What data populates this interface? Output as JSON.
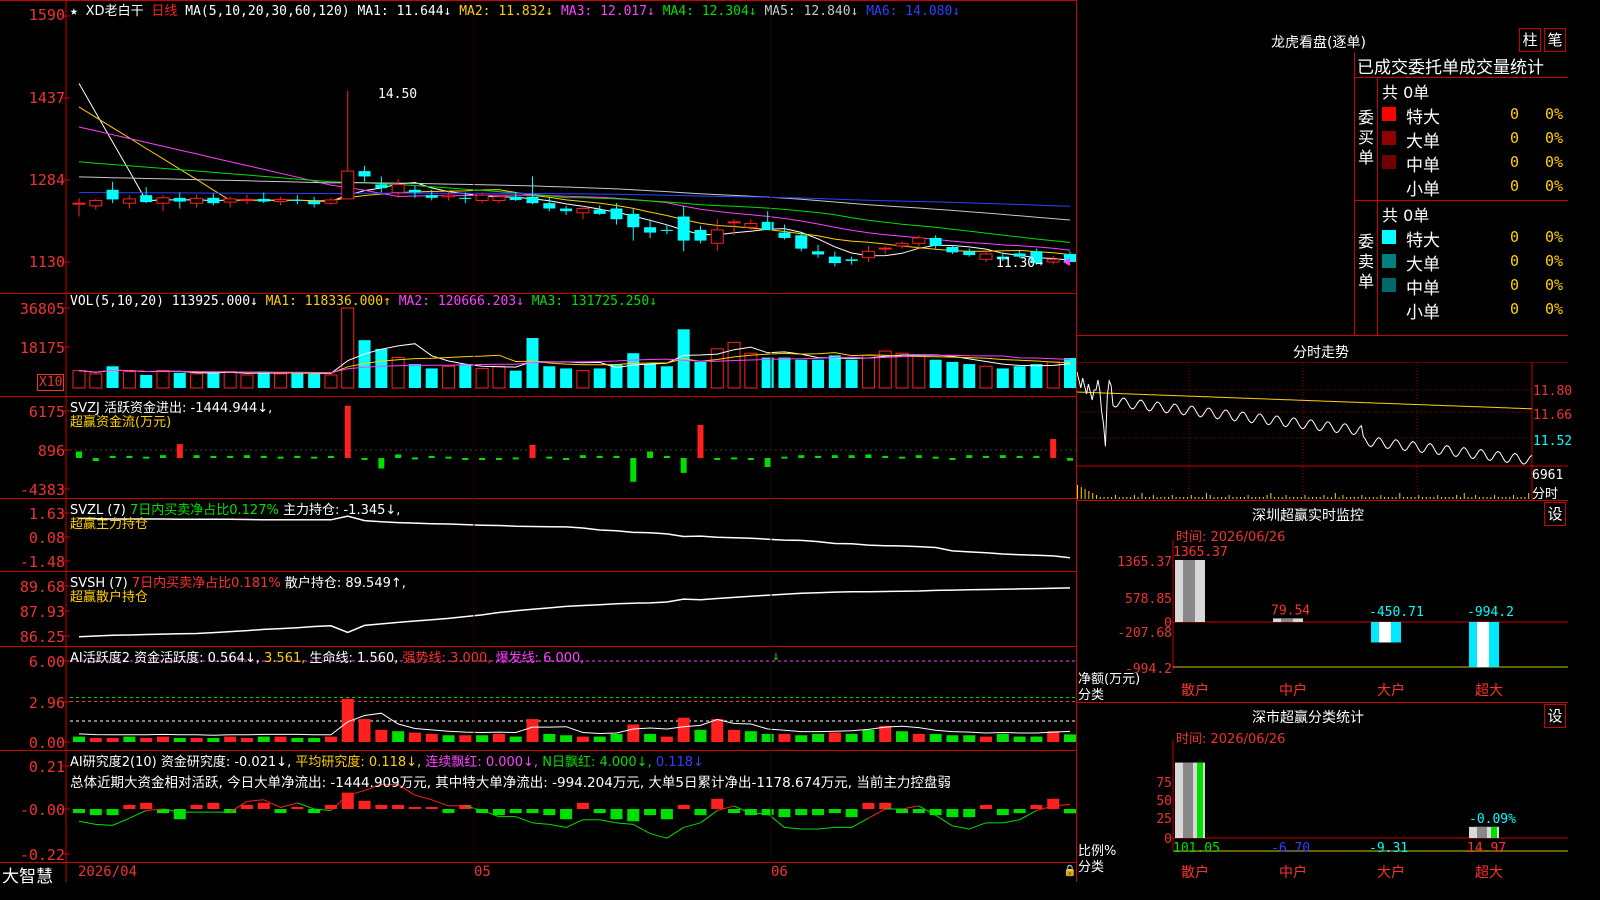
{
  "header": {
    "star": "★",
    "stock_name": "XD老白干",
    "period": "日线",
    "ma_def": "MA(5,10,20,30,60,120)",
    "ma_items": [
      {
        "label": "MA1: 11.644↓",
        "color": "#ffffff"
      },
      {
        "label": "MA2: 11.832↓",
        "color": "#ffd000"
      },
      {
        "label": "MA3: 12.017↓",
        "color": "#ff40ff"
      },
      {
        "label": "MA4: 12.304↓",
        "color": "#00e000"
      },
      {
        "label": "MA5: 12.840↓",
        "color": "#c8c8c8"
      },
      {
        "label": "MA6: 14.080↓",
        "color": "#3040ff"
      }
    ]
  },
  "panels": {
    "price": {
      "ticks": [
        "1590",
        "1437",
        "1284",
        "1130"
      ],
      "high_label": "14.50",
      "low_label": "11.30→"
    },
    "vol": {
      "ticks": [
        "36805",
        "18175"
      ],
      "unit_label": "X10",
      "def": "VOL(5,10,20)",
      "items": [
        {
          "label": "113925.000↓",
          "color": "#ffffff"
        },
        {
          "label": "MA1: 118336.000↑",
          "color": "#ffd000"
        },
        {
          "label": "MA2: 120666.203↓",
          "color": "#ff40ff"
        },
        {
          "label": "MA3: 131725.250↓",
          "color": "#00e000"
        }
      ]
    },
    "svzj": {
      "ticks": [
        "6175",
        "896",
        "-4383"
      ],
      "line1": "SVZJ  活跃资金进出: -1444.944↓,",
      "line2": "超赢资金流(万元)"
    },
    "svzl": {
      "ticks": [
        "1.63",
        "0.08",
        "-1.48"
      ],
      "line1a": "SVZL (7)",
      "line1b": "7日内买卖净占比0.127%",
      "line1c": "主力持仓: -1.345↓,",
      "line2": "超赢主力持仓"
    },
    "svsh": {
      "ticks": [
        "89.68",
        "87.93",
        "86.25"
      ],
      "line1a": "SVSH (7)",
      "line1b": "7日内买卖净占比0.181%",
      "line1c": "散户持仓: 89.549↑,",
      "line2": "超赢散户持仓"
    },
    "ai_active": {
      "ticks": [
        "6.00",
        "2.96",
        "0.00"
      ],
      "items": [
        {
          "label": "AI活跃度2 资金活跃度: 0.564↓,",
          "color": "#ffffff"
        },
        {
          "label": "3.561,",
          "color": "#ffd000"
        },
        {
          "label": "生命线: 1.560,",
          "color": "#ffffff"
        },
        {
          "label": "强势线: 3.000,",
          "color": "#ff3030"
        },
        {
          "label": "爆发线: 6.000,",
          "color": "#ff40ff"
        }
      ]
    },
    "ai_research": {
      "ticks": [
        "0.21",
        "-0.00",
        "-0.22"
      ],
      "items": [
        {
          "label": "AI研究度2(10) 资金研究度: -0.021↓,",
          "color": "#ffffff"
        },
        {
          "label": "平均研究度: 0.118↓,",
          "color": "#ffd000"
        },
        {
          "label": "连续飘红: 0.000↓,",
          "color": "#ff40ff"
        },
        {
          "label": "N日飘红: 4.000↓,",
          "color": "#00e000"
        },
        {
          "label": "0.118↓",
          "color": "#3040ff"
        }
      ],
      "summary": "总体近期大资金相对活跃, 今日大单净流出: -1444.909万元, 其中特大单净流出: -994.204万元, 大单5日累计净出-1178.674万元, 当前主力控盘弱"
    }
  },
  "date_axis": {
    "labels": [
      "2026/04",
      "05",
      "06"
    ]
  },
  "footer": {
    "brand": "大智慧"
  },
  "side": {
    "lhb": {
      "title": "龙虎看盘(逐单)",
      "btn_bar": "柱",
      "btn_stroke": "笔",
      "tabs": "已成交委托单成交量统计",
      "buy": {
        "label": "委买单",
        "total": "共 0单",
        "rows": [
          {
            "name": "特大",
            "count": "0",
            "pct": "0%",
            "color": "#ff0000"
          },
          {
            "name": "大单",
            "count": "0",
            "pct": "0%",
            "color": "#900000"
          },
          {
            "name": "中单",
            "count": "0",
            "pct": "0%",
            "color": "#700000"
          },
          {
            "name": "小单",
            "count": "0",
            "pct": "0%",
            "color": ""
          }
        ]
      },
      "sell": {
        "label": "委卖单",
        "total": "共 0单",
        "rows": [
          {
            "name": "特大",
            "count": "0",
            "pct": "0%",
            "color": "#00ffff"
          },
          {
            "name": "大单",
            "count": "0",
            "pct": "0%",
            "color": "#008080"
          },
          {
            "name": "中单",
            "count": "0",
            "pct": "0%",
            "color": "#006868"
          },
          {
            "name": "小单",
            "count": "0",
            "pct": "0%",
            "color": ""
          }
        ]
      }
    },
    "fenshi": {
      "title": "分时走势",
      "ticks": [
        "11.80",
        "11.66",
        "11.52"
      ],
      "vol_tick": "6961",
      "vol_unit": "分时"
    },
    "monitor": {
      "title": "深圳超赢实时监控",
      "btn": "设",
      "time": "时间: 2026/06/26",
      "ticks": [
        "1365.37",
        "578.85",
        "0",
        "-207.68",
        "-994.2"
      ],
      "y_label": "净额(万元)",
      "x_label": "分类",
      "categories": [
        "散户",
        "中户",
        "大户",
        "超大"
      ],
      "values": [
        1365.37,
        79.54,
        -450.71,
        -994.2
      ],
      "value_labels": [
        "1365.37",
        "79.54",
        "-450.71",
        "-994.2"
      ]
    },
    "classify": {
      "title": "深市超赢分类统计",
      "btn": "设",
      "time": "时间: 2026/06/26",
      "ticks": [
        "75",
        "50",
        "25",
        "0"
      ],
      "y_label": "比例%",
      "x_label": "分类",
      "categories": [
        "散户",
        "中户",
        "大户",
        "超大"
      ],
      "values": [
        101.05,
        -6.7,
        -9.31,
        14.97
      ],
      "value_labels": [
        "101.05",
        "-6.70",
        "-9.31",
        "14.97"
      ],
      "extra_label": "-0.09%"
    }
  },
  "chart_data": [
    {
      "type": "candlestick",
      "title": "XD老白干 日线",
      "ylabel": "",
      "ylim": [
        11.2,
        15.95
      ],
      "ohlc": [
        [
          12.4,
          12.5,
          12.15,
          12.4
        ],
        [
          12.35,
          12.48,
          12.28,
          12.45
        ],
        [
          12.65,
          12.8,
          12.4,
          12.47
        ],
        [
          12.4,
          12.55,
          12.3,
          12.48
        ],
        [
          12.55,
          12.7,
          12.4,
          12.42
        ],
        [
          12.4,
          12.55,
          12.25,
          12.5
        ],
        [
          12.5,
          12.6,
          12.3,
          12.43
        ],
        [
          12.4,
          12.56,
          12.32,
          12.49
        ],
        [
          12.5,
          12.58,
          12.36,
          12.4
        ],
        [
          12.42,
          12.52,
          12.32,
          12.48
        ],
        [
          12.45,
          12.56,
          12.38,
          12.47
        ],
        [
          12.48,
          12.6,
          12.4,
          12.43
        ],
        [
          12.43,
          12.52,
          12.36,
          12.47
        ],
        [
          12.46,
          12.55,
          12.38,
          12.44
        ],
        [
          12.44,
          12.52,
          12.32,
          12.38
        ],
        [
          12.4,
          12.5,
          12.36,
          12.46
        ],
        [
          12.48,
          14.5,
          12.7,
          13.0
        ],
        [
          13.0,
          13.1,
          12.8,
          12.9
        ],
        [
          12.75,
          12.9,
          12.6,
          12.68
        ],
        [
          12.6,
          12.85,
          12.5,
          12.75
        ],
        [
          12.65,
          12.72,
          12.5,
          12.6
        ],
        [
          12.55,
          12.65,
          12.45,
          12.5
        ],
        [
          12.52,
          12.62,
          12.45,
          12.55
        ],
        [
          12.5,
          12.6,
          12.4,
          12.48
        ],
        [
          12.45,
          12.6,
          12.4,
          12.55
        ],
        [
          12.45,
          12.55,
          12.4,
          12.52
        ],
        [
          12.52,
          12.6,
          12.44,
          12.46
        ],
        [
          12.52,
          12.9,
          12.38,
          12.4
        ],
        [
          12.4,
          12.5,
          12.25,
          12.3
        ],
        [
          12.3,
          12.35,
          12.18,
          12.25
        ],
        [
          12.22,
          12.35,
          12.1,
          12.3
        ],
        [
          12.28,
          12.36,
          12.18,
          12.2
        ],
        [
          12.3,
          12.4,
          12.0,
          12.1
        ],
        [
          12.2,
          12.3,
          11.7,
          11.95
        ],
        [
          11.95,
          12.1,
          11.75,
          11.85
        ],
        [
          11.9,
          12.0,
          11.82,
          11.88
        ],
        [
          12.15,
          12.35,
          11.5,
          11.7
        ],
        [
          11.9,
          11.98,
          11.65,
          11.7
        ],
        [
          11.65,
          12.1,
          11.5,
          11.9
        ],
        [
          12.05,
          12.1,
          11.8,
          12.05
        ],
        [
          11.95,
          12.1,
          11.9,
          12.02
        ],
        [
          12.05,
          12.25,
          11.9,
          11.9
        ],
        [
          11.85,
          12.0,
          11.72,
          11.75
        ],
        [
          11.8,
          11.85,
          11.5,
          11.55
        ],
        [
          11.5,
          11.62,
          11.38,
          11.44
        ],
        [
          11.4,
          11.5,
          11.22,
          11.28
        ],
        [
          11.35,
          11.4,
          11.25,
          11.32
        ],
        [
          11.38,
          11.6,
          11.3,
          11.5
        ],
        [
          11.55,
          11.6,
          11.45,
          11.56
        ],
        [
          11.6,
          11.68,
          11.55,
          11.65
        ],
        [
          11.65,
          11.8,
          11.55,
          11.75
        ],
        [
          11.75,
          11.8,
          11.55,
          11.6
        ],
        [
          11.58,
          11.62,
          11.45,
          11.48
        ],
        [
          11.5,
          11.55,
          11.4,
          11.43
        ],
        [
          11.35,
          11.48,
          11.3,
          11.45
        ],
        [
          11.4,
          11.48,
          11.32,
          11.35
        ],
        [
          11.46,
          11.52,
          11.38,
          11.4
        ],
        [
          11.5,
          11.55,
          11.25,
          11.28
        ],
        [
          11.3,
          11.42,
          11.25,
          11.35
        ],
        [
          11.45,
          11.5,
          11.3,
          11.3
        ]
      ]
    },
    {
      "type": "bar",
      "title": "VOL(5,10,20)",
      "ylim": [
        0,
        42000
      ],
      "values": [
        8000,
        6500,
        10000,
        7500,
        6000,
        8000,
        7000,
        6500,
        7000,
        7500,
        6000,
        7500,
        6500,
        7000,
        6500,
        6000,
        36805,
        22000,
        18000,
        14000,
        11000,
        9000,
        10000,
        11000,
        9000,
        10000,
        8000,
        23000,
        10000,
        9000,
        8000,
        9000,
        11000,
        16000,
        11000,
        10000,
        27000,
        12000,
        18000,
        21000,
        16000,
        14000,
        14000,
        13000,
        13000,
        15000,
        13000,
        15000,
        17000,
        16000,
        15000,
        13000,
        12000,
        11000,
        10000,
        9000,
        10000,
        11000,
        12000,
        13800
      ]
    },
    {
      "type": "bar",
      "title": "超赢资金流(万元)",
      "ylim": [
        -4383,
        6175
      ],
      "values": [
        -200,
        -1500,
        -800,
        -800,
        -900,
        -700,
        800,
        -700,
        -800,
        -800,
        -700,
        -800,
        -900,
        -800,
        -900,
        -800,
        6000,
        -1200,
        -2500,
        -600,
        -1000,
        -800,
        -900,
        -1300,
        -1200,
        -1100,
        -1000,
        700,
        -900,
        -1200,
        -700,
        -800,
        -800,
        -4300,
        -200,
        -800,
        -3100,
        3400,
        -1200,
        -1000,
        -1100,
        -2300,
        -900,
        -700,
        -800,
        -700,
        -700,
        -600,
        -800,
        -900,
        -700,
        -900,
        -1200,
        -700,
        -800,
        -700,
        -800,
        -800,
        1500,
        -1444.944
      ]
    },
    {
      "type": "line",
      "title": "超赢主力持仓",
      "ylim": [
        -1.48,
        1.63
      ],
      "values": [
        1.2,
        1.18,
        1.16,
        1.16,
        1.16,
        1.16,
        1.15,
        1.15,
        1.14,
        1.14,
        1.13,
        1.12,
        1.12,
        1.12,
        1.12,
        1.11,
        1.35,
        1.06,
        0.98,
        0.93,
        0.9,
        0.86,
        0.84,
        0.8,
        0.76,
        0.74,
        0.7,
        0.68,
        0.66,
        0.65,
        0.58,
        0.45,
        0.4,
        0.3,
        0.28,
        0.2,
        0.03,
        0.06,
        -0.02,
        -0.05,
        -0.08,
        -0.14,
        -0.2,
        -0.22,
        -0.3,
        -0.42,
        -0.44,
        -0.52,
        -0.56,
        -0.58,
        -0.62,
        -0.68,
        -0.9,
        -0.96,
        -1.02,
        -1.1,
        -1.14,
        -1.18,
        -1.22,
        -1.345
      ]
    },
    {
      "type": "line",
      "title": "超赢散户持仓",
      "ylim": [
        86.25,
        89.68
      ],
      "values": [
        86.2,
        86.25,
        86.3,
        86.32,
        86.35,
        86.38,
        86.4,
        86.42,
        86.48,
        86.55,
        86.62,
        86.7,
        86.76,
        86.82,
        86.9,
        86.95,
        86.5,
        86.98,
        87.08,
        87.18,
        87.28,
        87.36,
        87.46,
        87.58,
        87.7,
        87.86,
        87.98,
        88.08,
        88.18,
        88.28,
        88.34,
        88.4,
        88.46,
        88.5,
        88.52,
        88.58,
        88.78,
        88.74,
        88.82,
        88.9,
        88.98,
        89.05,
        89.12,
        89.18,
        89.22,
        89.26,
        89.28,
        89.28,
        89.3,
        89.32,
        89.34,
        89.38,
        89.4,
        89.42,
        89.44,
        89.46,
        89.48,
        89.5,
        89.52,
        89.549
      ]
    },
    {
      "type": "bar",
      "title": "AI活跃度2",
      "ylim": [
        0,
        6.0
      ],
      "values": [
        0.4,
        0.3,
        0.3,
        0.4,
        0.3,
        0.4,
        0.3,
        0.3,
        0.3,
        0.4,
        0.3,
        0.4,
        0.4,
        0.3,
        0.3,
        0.4,
        3.2,
        1.7,
        0.9,
        0.8,
        0.7,
        0.6,
        0.5,
        0.5,
        0.5,
        0.6,
        0.4,
        1.7,
        0.6,
        0.5,
        0.4,
        0.4,
        0.6,
        1.3,
        0.6,
        0.4,
        1.8,
        0.9,
        1.7,
        0.9,
        0.8,
        0.6,
        0.6,
        0.5,
        0.6,
        0.7,
        0.6,
        0.9,
        1.2,
        0.8,
        0.6,
        0.6,
        0.5,
        0.5,
        0.4,
        0.6,
        0.4,
        0.4,
        0.8,
        0.564
      ],
      "up": [
        false,
        true,
        true,
        false,
        true,
        true,
        false,
        true,
        false,
        true,
        true,
        false,
        true,
        false,
        false,
        true,
        true,
        true,
        true,
        false,
        true,
        true,
        false,
        true,
        false,
        true,
        false,
        true,
        false,
        false,
        true,
        false,
        false,
        true,
        false,
        true,
        true,
        false,
        true,
        true,
        false,
        false,
        true,
        false,
        false,
        true,
        false,
        false,
        true,
        false,
        true,
        false,
        false,
        false,
        true,
        false,
        false,
        false,
        true,
        false
      ],
      "life_line": 1.56,
      "strong_line": 3.0,
      "burst_line": 6.0
    },
    {
      "type": "bar",
      "title": "AI研究度2(10)",
      "ylim": [
        -0.22,
        0.21
      ],
      "values": [
        -0.02,
        -0.03,
        -0.03,
        0.02,
        0.03,
        -0.02,
        -0.05,
        0.02,
        0.03,
        -0.02,
        0.02,
        0.03,
        -0.02,
        0.01,
        -0.02,
        0.02,
        0.08,
        0.04,
        0.02,
        0.02,
        0.01,
        0.01,
        -0.02,
        0.02,
        -0.02,
        -0.03,
        -0.02,
        -0.02,
        -0.03,
        -0.05,
        0.03,
        -0.02,
        -0.05,
        -0.06,
        -0.03,
        -0.05,
        0.02,
        -0.03,
        0.05,
        -0.02,
        -0.03,
        -0.03,
        -0.04,
        -0.03,
        -0.03,
        -0.02,
        -0.04,
        0.03,
        0.03,
        -0.02,
        -0.02,
        -0.03,
        -0.04,
        -0.04,
        0.02,
        -0.03,
        -0.02,
        0.02,
        0.05,
        -0.021
      ]
    }
  ]
}
